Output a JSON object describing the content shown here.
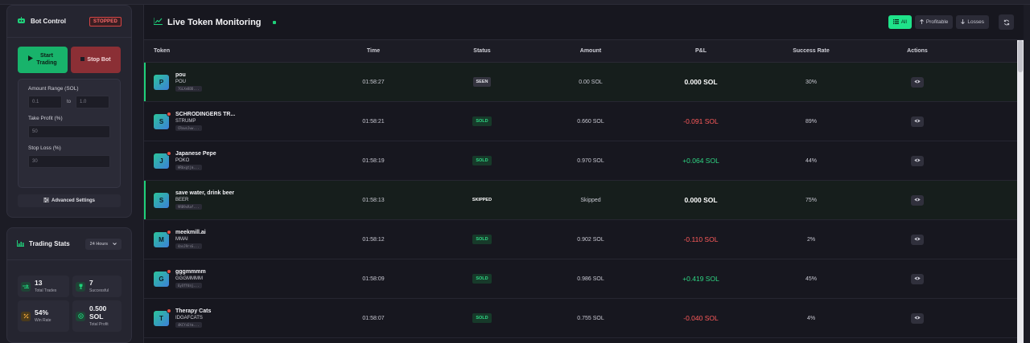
{
  "bot_control": {
    "title": "Bot Control",
    "status_badge": "STOPPED",
    "start_label_line1": "Start",
    "start_label_line2": "Trading",
    "stop_label": "Stop Bot",
    "amount_range_label": "Amount Range (SOL)",
    "amount_min_placeholder": "0.1",
    "range_separator": "to",
    "amount_max_placeholder": "1.0",
    "take_profit_label": "Take Profit (%)",
    "take_profit_placeholder": "50",
    "stop_loss_label": "Stop Loss (%)",
    "stop_loss_placeholder": "30",
    "advanced_label": "Advanced Settings"
  },
  "trading_stats": {
    "title": "Trading Stats",
    "period": "24 Hours",
    "total_trades_value": "13",
    "total_trades_label": "Total Trades",
    "successful_value": "7",
    "successful_label": "Successful",
    "win_rate_value": "54%",
    "win_rate_label": "Win Rate",
    "total_profit_value_line1": "0.500",
    "total_profit_value_line2": "SOL",
    "total_profit_label": "Total Profit"
  },
  "monitor": {
    "title": "Live Token Monitoring",
    "filters": {
      "all": "All",
      "profitable": "Profitable",
      "losses": "Losses"
    },
    "columns": {
      "token": "Token",
      "time": "Time",
      "status": "Status",
      "amount": "Amount",
      "pnl": "P&L",
      "success_rate": "Success Rate",
      "actions": "Actions"
    },
    "rows": [
      {
        "letter": "P",
        "name": "pou",
        "symbol": "POU",
        "address": "7GLXeBDD...",
        "time": "01:58:27",
        "status": "SEEN",
        "amount": "0.00 SOL",
        "pnl": "0.000 SOL",
        "success_rate": "30%"
      },
      {
        "letter": "S",
        "name": "SCHRODINGERS TR...",
        "symbol": "STRUMP",
        "address": "CRxwsJww...",
        "time": "01:58:21",
        "status": "SOLD",
        "amount": "0.660 SOL",
        "pnl": "-0.091 SOL",
        "success_rate": "89%"
      },
      {
        "letter": "J",
        "name": "Japanese Pepe",
        "symbol": "POKO",
        "address": "HRbxgtjm...",
        "time": "01:58:19",
        "status": "SOLD",
        "amount": "0.970 SOL",
        "pnl": "+0.064 SOL",
        "success_rate": "44%"
      },
      {
        "letter": "S",
        "name": "save water, drink beer",
        "symbol": "BEER",
        "address": "9RB9xRaf...",
        "time": "01:58:13",
        "status": "SKIPPED",
        "amount": "Skipped",
        "pnl": "0.000 SOL",
        "success_rate": "75%"
      },
      {
        "letter": "M",
        "name": "meekmill.ai",
        "symbol": "MMAI",
        "address": "4asJ9rsG...",
        "time": "01:58:12",
        "status": "SOLD",
        "amount": "0.902 SOL",
        "pnl": "-0.110 SOL",
        "success_rate": "2%"
      },
      {
        "letter": "G",
        "name": "gggmmmm",
        "symbol": "GGGMMMM",
        "address": "6yXfYdnj...",
        "time": "01:58:09",
        "status": "SOLD",
        "amount": "0.986 SOL",
        "pnl": "+0.419 SOL",
        "success_rate": "45%"
      },
      {
        "letter": "T",
        "name": "Therapy Cats",
        "symbol": "IDGAFCATS",
        "address": "4KCYsEtm...",
        "time": "01:58:07",
        "status": "SOLD",
        "amount": "0.755 SOL",
        "pnl": "-0.040 SOL",
        "success_rate": "4%"
      }
    ]
  },
  "colors": {
    "accent_green": "#1fe38a",
    "profit": "#2fd784",
    "loss": "#ff5b5b",
    "stop_red": "#8b2f35"
  }
}
